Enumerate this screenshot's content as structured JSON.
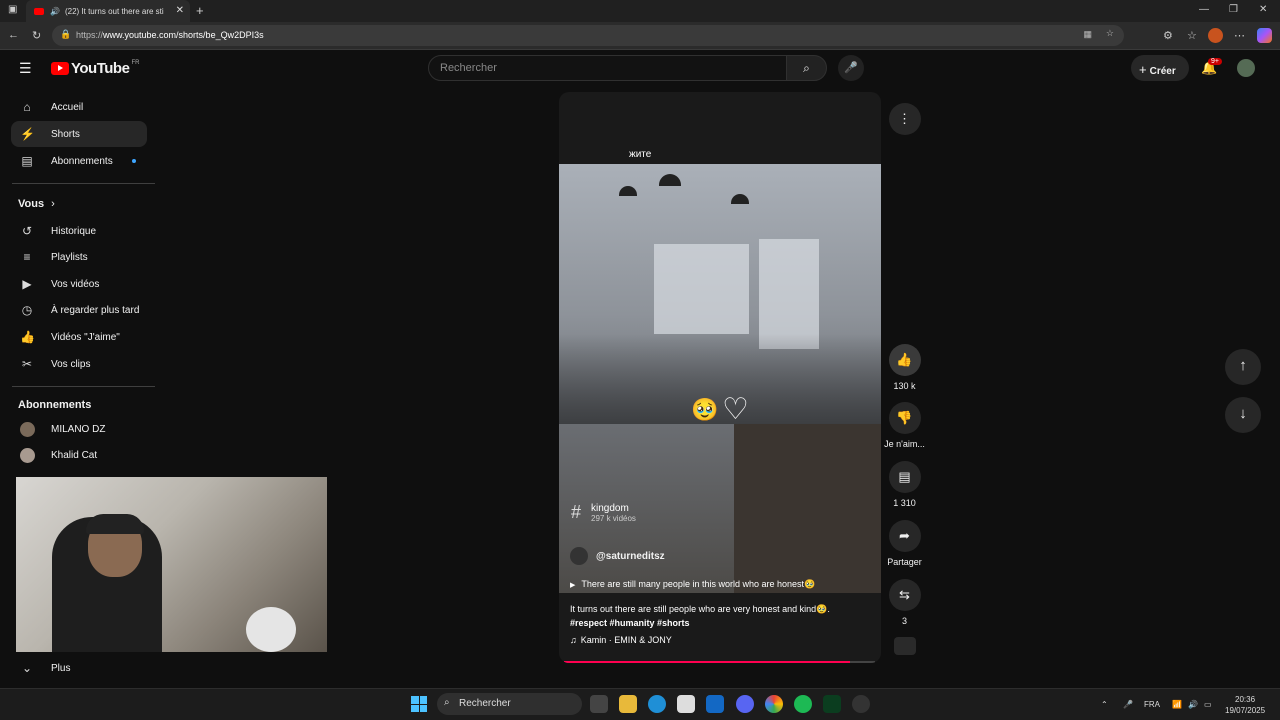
{
  "browser": {
    "tab_title": "(22) It turns out there are sti",
    "url_prefix": "https://",
    "url_main": "www.youtube.com/shorts/be_Qw2DPI3s"
  },
  "header": {
    "logo": "YouTube",
    "region": "FR",
    "search_placeholder": "Rechercher",
    "create_label": "Créer",
    "notif_badge": "9+"
  },
  "sidebar": {
    "items": [
      {
        "label": "Accueil",
        "icon": "home-icon"
      },
      {
        "label": "Shorts",
        "icon": "shorts-icon"
      },
      {
        "label": "Abonnements",
        "icon": "subscriptions-icon"
      }
    ],
    "you_label": "Vous",
    "you_items": [
      {
        "label": "Historique",
        "icon": "history-icon"
      },
      {
        "label": "Playlists",
        "icon": "playlists-icon"
      },
      {
        "label": "Vos vidéos",
        "icon": "your-videos-icon"
      },
      {
        "label": "À regarder plus tard",
        "icon": "watch-later-icon"
      },
      {
        "label": "Vidéos \"J'aime\"",
        "icon": "liked-videos-icon"
      },
      {
        "label": "Vos clips",
        "icon": "clips-icon"
      }
    ],
    "subs_label": "Abonnements",
    "subs": [
      {
        "label": "MILANO DZ"
      },
      {
        "label": "Khalid Cat"
      }
    ],
    "more_label": "Plus"
  },
  "short": {
    "caption_overlay": "жите",
    "chip_title": "kingdom",
    "chip_sub": "297 k vidéos",
    "channel": "@saturneditsz",
    "quote": "There are still many people in this world who are honest🥹",
    "desc": "It turns out there are still people who are very honest and kind🥹.",
    "tags": "#respect  #humanity #shorts",
    "music": "Kamin · EMIN & JONY",
    "progress": 0.92
  },
  "actions": {
    "likes": "130 k",
    "dislike": "Je n'aim...",
    "comments": "1 310",
    "share": "Partager",
    "remix": "3"
  },
  "taskbar": {
    "search": "Rechercher",
    "lang": "FRA",
    "time": "20:36",
    "date": "19/07/2025"
  }
}
